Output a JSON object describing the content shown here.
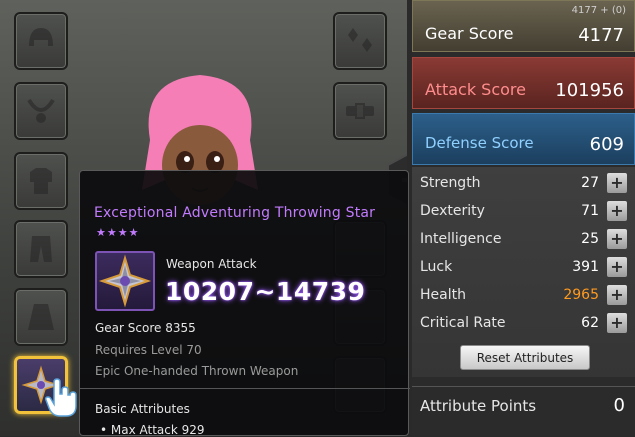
{
  "tooltip": {
    "item_name": "Exceptional Adventuring Throwing Star",
    "stars": "★★★★",
    "weapon_attack_label": "Weapon Attack",
    "weapon_attack_value": "10207~14739",
    "gear_score": "Gear Score 8355",
    "requirement": "Requires Level 70",
    "type": "Epic One-handed Thrown Weapon",
    "basic_attributes_header": "Basic Attributes",
    "max_attack": "• Max Attack 929"
  },
  "gear": {
    "small": "4177 + (0)",
    "label": "Gear Score",
    "value": "4177"
  },
  "attack": {
    "label": "Attack Score",
    "value": "101956"
  },
  "defense": {
    "label": "Defense Score",
    "value": "609"
  },
  "stats": [
    {
      "label": "Strength",
      "value": "27"
    },
    {
      "label": "Dexterity",
      "value": "71"
    },
    {
      "label": "Intelligence",
      "value": "25"
    },
    {
      "label": "Luck",
      "value": "391"
    },
    {
      "label": "Health",
      "value": "2965"
    },
    {
      "label": "Critical Rate",
      "value": "62"
    }
  ],
  "plus_symbol": "+",
  "reset_label": "Reset Attributes",
  "ap": {
    "label": "Attribute Points",
    "value": "0"
  },
  "colors": {
    "epic": "#c27bff",
    "health_value": "#ff9a1f",
    "selected_slot": "#f2c33a"
  },
  "icons": [
    "helmet-icon",
    "necklace-icon",
    "top-armor-icon",
    "pants-icon",
    "cape-icon",
    "throwing-star-icon",
    "earring-icon",
    "belt-icon",
    "plus-icon",
    "hand-cursor-icon"
  ]
}
